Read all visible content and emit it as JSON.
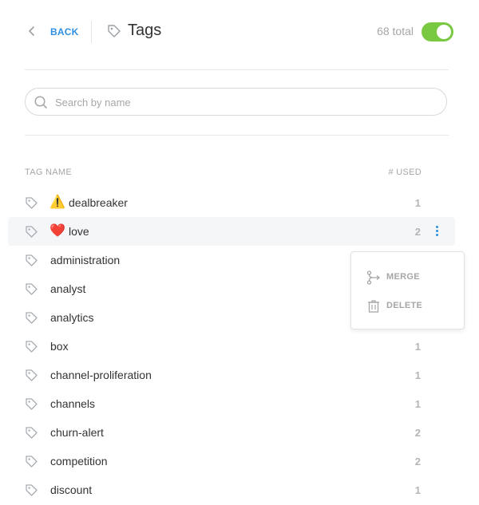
{
  "header": {
    "back_label": "BACK",
    "title": "Tags",
    "total": "68 total",
    "toggle_on": true
  },
  "search": {
    "placeholder": "Search by name",
    "value": ""
  },
  "table": {
    "col_name": "TAG NAME",
    "col_used": "# USED",
    "rows": [
      {
        "emoji": "⚠️",
        "name": "dealbreaker",
        "count": "1"
      },
      {
        "emoji": "❤️",
        "name": "love",
        "count": "2"
      },
      {
        "name": "administration",
        "count": ""
      },
      {
        "name": "analyst",
        "count": ""
      },
      {
        "name": "analytics",
        "count": ""
      },
      {
        "name": "box",
        "count": "1"
      },
      {
        "name": "channel-proliferation",
        "count": "1"
      },
      {
        "name": "channels",
        "count": "1"
      },
      {
        "name": "churn-alert",
        "count": "2"
      },
      {
        "name": "competition",
        "count": "2"
      },
      {
        "name": "discount",
        "count": "1"
      }
    ]
  },
  "context_menu": {
    "merge_label": "MERGE",
    "delete_label": "DELETE"
  },
  "colors": {
    "accent": "#2f8fe0",
    "toggle": "#7ac943",
    "muted": "#a6a6a6"
  }
}
